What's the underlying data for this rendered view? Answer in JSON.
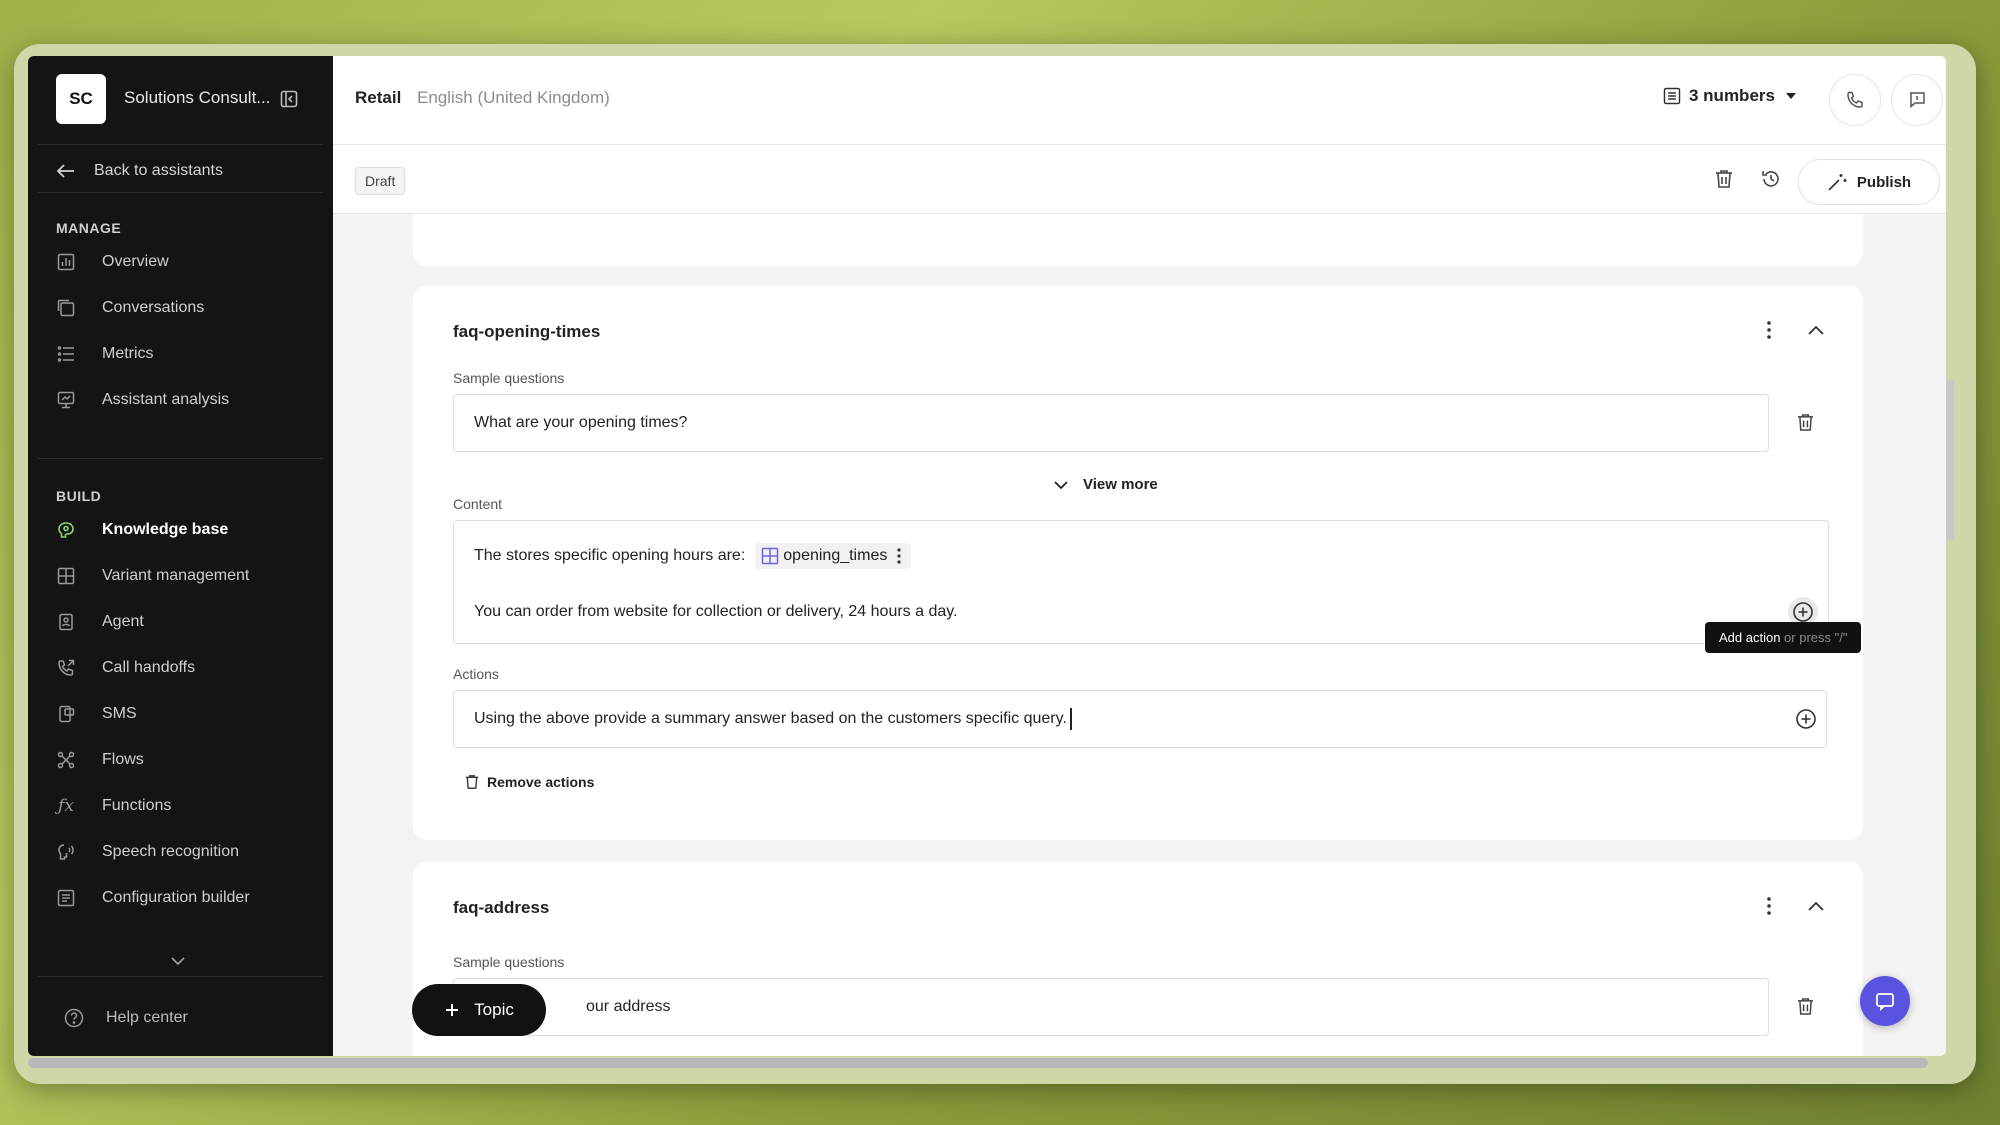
{
  "sidebar": {
    "avatar": "SC",
    "org_name": "Solutions Consult...",
    "back": "Back to assistants",
    "manage_label": "MANAGE",
    "manage_items": [
      "Overview",
      "Conversations",
      "Metrics",
      "Assistant analysis"
    ],
    "build_label": "BUILD",
    "build_items": [
      "Knowledge base",
      "Variant management",
      "Agent",
      "Call handoffs",
      "SMS",
      "Flows",
      "Functions",
      "Speech recognition",
      "Configuration builder"
    ],
    "active_item": "Knowledge base",
    "help": "Help center"
  },
  "header": {
    "title": "Retail",
    "language": "English (United Kingdom)",
    "numbers": "3 numbers"
  },
  "toolbar": {
    "status": "Draft",
    "publish": "Publish"
  },
  "cards": [
    {
      "title": "faq-opening-times",
      "sample_label": "Sample questions",
      "sample_question": "What are your opening times?",
      "view_more": "View more",
      "content_label": "Content",
      "content_line1": "The stores specific opening hours are:",
      "variable": "opening_times",
      "content_line2": "You can order from website for collection or delivery, 24 hours a day.",
      "actions_label": "Actions",
      "actions_text": "Using the above provide a summary answer based on the customers specific query.",
      "remove_actions": "Remove actions"
    },
    {
      "title": "faq-address",
      "sample_label": "Sample questions",
      "sample_question_partial": "our address"
    }
  ],
  "tooltip": {
    "main": "Add action",
    "hint": " or press \"/\""
  },
  "topic_button": "Topic",
  "colors": {
    "sidebar_bg": "#141414",
    "active_accent": "#8fd46a",
    "chat_fab": "#5a53e0",
    "variable_icon": "#6b63e6"
  }
}
